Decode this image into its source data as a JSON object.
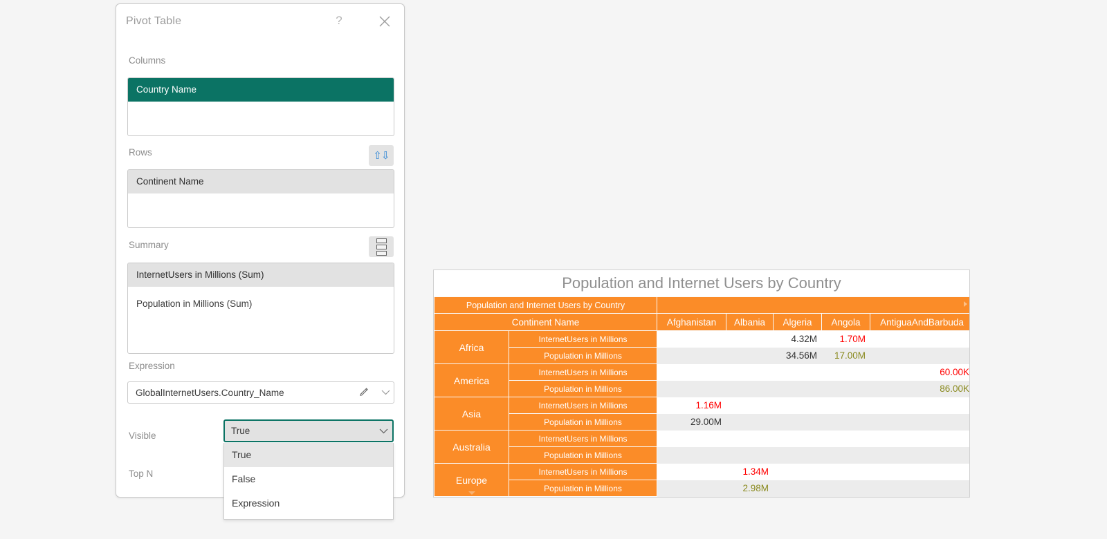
{
  "dialog": {
    "title": "Pivot Table",
    "help_label": "?",
    "close_icon": "close-icon",
    "columns": {
      "label": "Columns",
      "items": [
        {
          "label": "Country Name",
          "state": "selected-teal"
        }
      ]
    },
    "rows": {
      "label": "Rows",
      "sort_button_icon": "sort-ascending-descending-icon",
      "items": [
        {
          "label": "Continent Name",
          "state": "selected-grey"
        }
      ]
    },
    "summary": {
      "label": "Summary",
      "list_button_icon": "stacked-list-icon",
      "items": [
        {
          "label": "InternetUsers in Millions (Sum)",
          "state": "selected-grey"
        },
        {
          "label": "Population in Millions (Sum)",
          "state": "none"
        }
      ]
    },
    "expression": {
      "label": "Expression",
      "value": "GlobalInternetUsers.Country_Name",
      "edit_icon": "pencil-icon",
      "dropdown_icon": "chevron-down-icon"
    },
    "visible": {
      "label": "Visible",
      "value": "True",
      "dropdown_icon": "chevron-down-icon",
      "options": [
        "True",
        "False",
        "Expression"
      ],
      "highlighted_option": "True",
      "open": true
    },
    "topn": {
      "label": "Top N"
    },
    "accent_teal": "#0b7364"
  },
  "chart_data": {
    "type": "table",
    "title": "Population and Internet Users by Country",
    "corner_label": "Population and Internet Users by Country",
    "row_axis_label": "Continent Name",
    "categories": [
      "Afghanistan",
      "Albania",
      "Algeria",
      "Angola",
      "AntiguaAndBarbuda"
    ],
    "measures": [
      "InternetUsers in Millions",
      "Population in Millions"
    ],
    "rows": [
      {
        "group": "Africa",
        "series": [
          {
            "name": "InternetUsers in Millions",
            "values": [
              "",
              "",
              "4.32M",
              "1.70M",
              ""
            ],
            "colors": [
              "",
              "",
              "dark",
              "red",
              ""
            ]
          },
          {
            "name": "Population in Millions",
            "values": [
              "",
              "",
              "34.56M",
              "17.00M",
              ""
            ],
            "colors": [
              "",
              "",
              "dark",
              "olive",
              ""
            ]
          }
        ]
      },
      {
        "group": "America",
        "series": [
          {
            "name": "InternetUsers in Millions",
            "values": [
              "",
              "",
              "",
              "",
              "60.00K"
            ],
            "colors": [
              "",
              "",
              "",
              "",
              "red"
            ]
          },
          {
            "name": "Population in Millions",
            "values": [
              "",
              "",
              "",
              "",
              "86.00K"
            ],
            "colors": [
              "",
              "",
              "",
              "",
              "olive"
            ]
          }
        ]
      },
      {
        "group": "Asia",
        "series": [
          {
            "name": "InternetUsers in Millions",
            "values": [
              "1.16M",
              "",
              "",
              "",
              ""
            ],
            "colors": [
              "red",
              "",
              "",
              "",
              ""
            ]
          },
          {
            "name": "Population in Millions",
            "values": [
              "29.00M",
              "",
              "",
              "",
              ""
            ],
            "colors": [
              "dark",
              "",
              "",
              "",
              ""
            ]
          }
        ]
      },
      {
        "group": "Australia",
        "series": [
          {
            "name": "InternetUsers in Millions",
            "values": [
              "",
              "",
              "",
              "",
              ""
            ],
            "colors": [
              "",
              "",
              "",
              "",
              ""
            ]
          },
          {
            "name": "Population in Millions",
            "values": [
              "",
              "",
              "",
              "",
              ""
            ],
            "colors": [
              "",
              "",
              "",
              "",
              ""
            ]
          }
        ]
      },
      {
        "group": "Europe",
        "expandable": true,
        "series": [
          {
            "name": "InternetUsers in Millions",
            "values": [
              "",
              "1.34M",
              "",
              "",
              ""
            ],
            "colors": [
              "",
              "red",
              "",
              "",
              ""
            ]
          },
          {
            "name": "Population in Millions",
            "values": [
              "",
              "2.98M",
              "",
              "",
              ""
            ],
            "colors": [
              "",
              "olive",
              "",
              "",
              ""
            ]
          }
        ]
      }
    ],
    "header_color": "#fb8c28",
    "value_colors": {
      "dark": "#333333",
      "red": "#ff0000",
      "olive": "#8a8a1f"
    },
    "legend": [],
    "grid": true
  }
}
